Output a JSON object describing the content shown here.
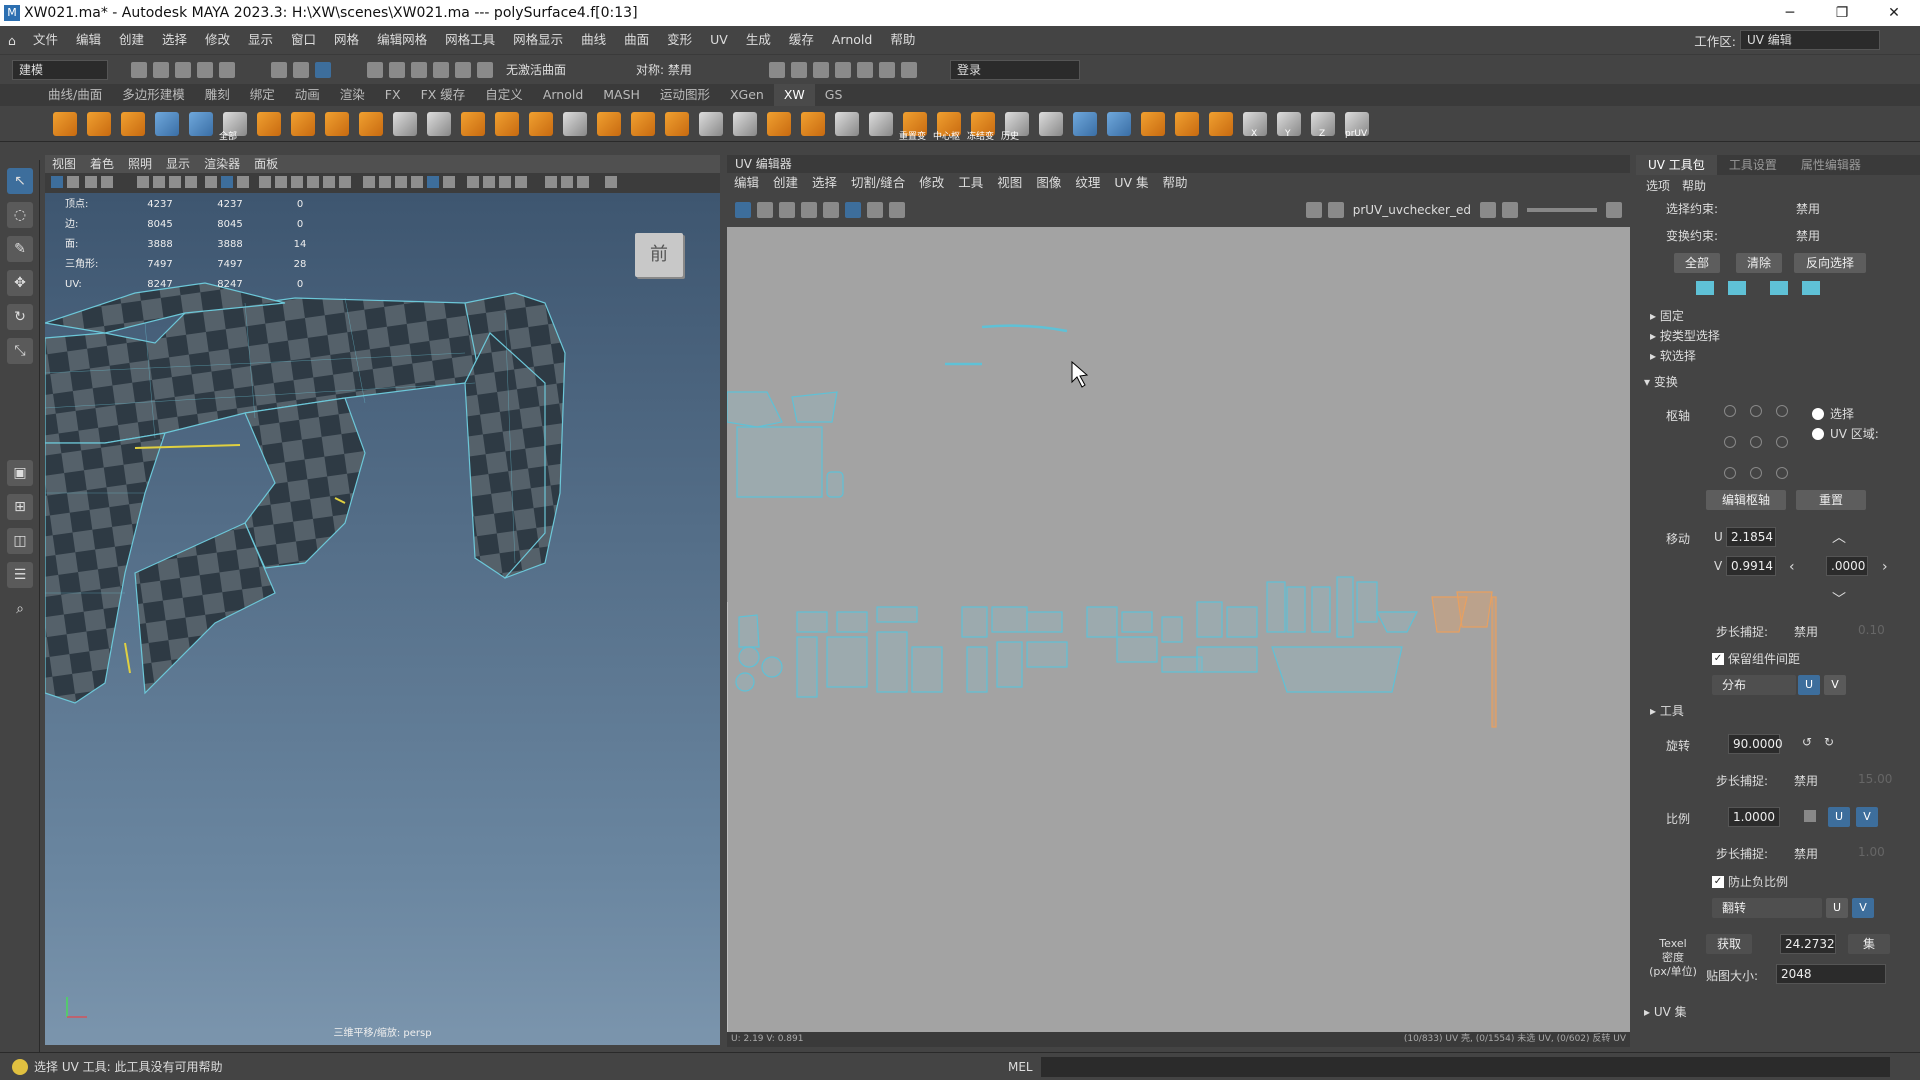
{
  "window": {
    "title": "XW021.ma* - Autodesk MAYA 2023.3: H:\\XW\\scenes\\XW021.ma   ---   polySurface4.f[0:13]",
    "minimize": "─",
    "maximize": "❐",
    "close": "✕"
  },
  "menubar": {
    "items": [
      "文件",
      "编辑",
      "创建",
      "选择",
      "修改",
      "显示",
      "窗口",
      "网格",
      "编辑网格",
      "网格工具",
      "网格显示",
      "曲线",
      "曲面",
      "变形",
      "UV",
      "生成",
      "缓存",
      "Arnold",
      "帮助"
    ],
    "workspace_label": "工作区:",
    "workspace_value": "UV 编辑"
  },
  "toolbar": {
    "mode": "建模",
    "live_surface": "无激活曲面",
    "symmetry": "对称: 禁用",
    "login": "登录"
  },
  "shelf": {
    "tabs": [
      "曲线/曲面",
      "多边形建模",
      "雕刻",
      "绑定",
      "动画",
      "渲染",
      "FX",
      "FX 缓存",
      "自定义",
      "Arnold",
      "MASH",
      "运动图形",
      "XGen",
      "XW",
      "GS"
    ],
    "active_tab": "XW",
    "captions": [
      "全部",
      "重置变",
      "中心枢",
      "冻结变",
      "历史",
      "X",
      "Y",
      "Z",
      "X",
      "Y",
      "Z",
      "prUV"
    ]
  },
  "viewport": {
    "menu": [
      "视图",
      "着色",
      "照明",
      "显示",
      "渲染器",
      "面板"
    ],
    "hud": [
      {
        "label": "顶点:",
        "a": "4237",
        "b": "4237",
        "c": "0"
      },
      {
        "label": "边:",
        "a": "8045",
        "b": "8045",
        "c": "0"
      },
      {
        "label": "面:",
        "a": "3888",
        "b": "3888",
        "c": "14"
      },
      {
        "label": "三角形:",
        "a": "7497",
        "b": "7497",
        "c": "28"
      },
      {
        "label": "UV:",
        "a": "8247",
        "b": "8247",
        "c": "0"
      }
    ],
    "viewcube_label": "前",
    "camera_label": "三维平移/缩放: persp"
  },
  "uv_editor": {
    "title": "UV 编辑器",
    "menu": [
      "编辑",
      "创建",
      "选择",
      "切割/缝合",
      "修改",
      "工具",
      "视图",
      "图像",
      "纹理",
      "UV 集",
      "帮助"
    ],
    "texture_name": "prUV_uvchecker_ed",
    "status_left": "U: 2.19  V: 0.891",
    "status_right": "(10/833) UV 壳, (0/1554) 未选 UV, (0/602) 反转 UV"
  },
  "right_panel": {
    "tabs": [
      "UV 工具包",
      "工具设置",
      "属性编辑器"
    ],
    "active_tab": "UV 工具包",
    "menu": [
      "选项",
      "帮助"
    ],
    "selection_constraint_label": "选择约束:",
    "selection_constraint_value": "禁用",
    "transform_constraint_label": "变换约束:",
    "transform_constraint_value": "禁用",
    "buttons": {
      "all": "全部",
      "clear": "清除",
      "invert": "反向选择"
    },
    "sections": {
      "pin": "固定",
      "by_type": "按类型选择",
      "soft": "软选择",
      "transform": "变换",
      "tools": "工具",
      "uvsets": "UV 集"
    },
    "pivot_label": "枢轴",
    "pivot_options": {
      "selection": "选择",
      "uv_region": "UV 区域:"
    },
    "edit_pivot": "编辑枢轴",
    "reset": "重置",
    "move_label": "移动",
    "u_label": "U",
    "u_value": "2.1854",
    "v_label": "V",
    "v_value": "0.9914",
    "step_value": ".0000",
    "step_snap_label": "步长捕捉:",
    "step_snap_value": "禁用",
    "step_snap_amount": "0.10",
    "keep_spacing": "保留组件间距",
    "distribute": "分布",
    "u_btn": "U",
    "v_btn": "V",
    "rotate_label": "旋转",
    "rotate_value": "90.0000",
    "rotate_step_amount": "15.00",
    "scale_label": "比例",
    "scale_value": "1.0000",
    "scale_step_amount": "1.00",
    "prevent_negative": "防止负比例",
    "flip": "翻转",
    "texel_label": "Texel\n密度\n(px/单位)",
    "texel_get": "获取",
    "texel_value": "24.2732",
    "texel_set": "集",
    "map_size_label": "贴图大小:",
    "map_size_value": "2048"
  },
  "cmd": {
    "mel": "MEL",
    "help": "选择 UV 工具: 此工具没有可用帮助"
  },
  "colors": {
    "uv_shell": "#5fc1d6",
    "uv_shell_selected": "#e8a060",
    "accent": "#3d6e9c"
  }
}
